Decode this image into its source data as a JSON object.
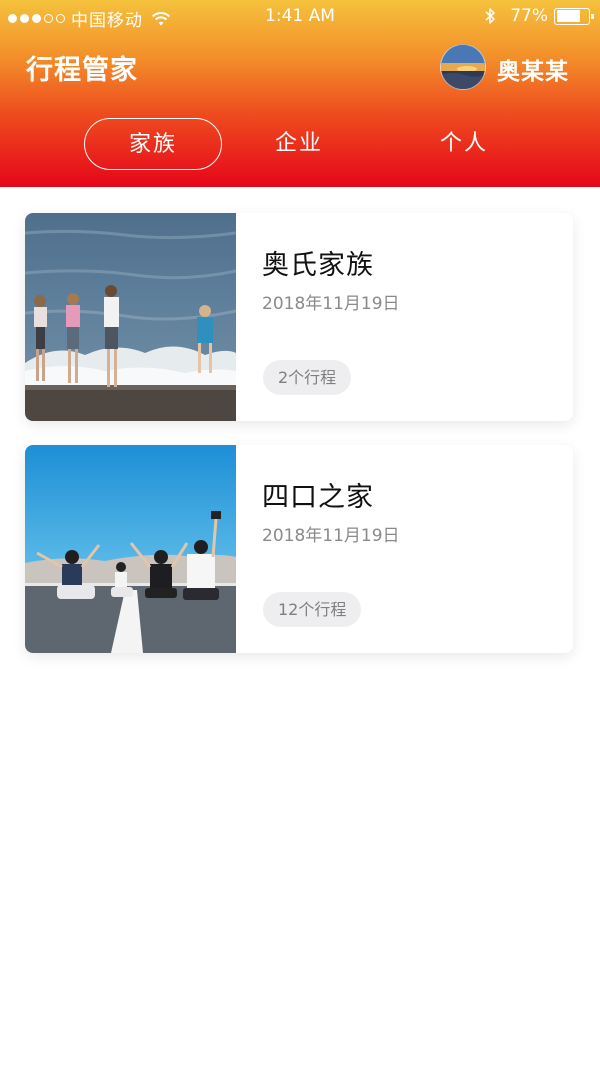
{
  "status_bar": {
    "carrier": "中国移动",
    "time": "1:41 AM",
    "battery": "77%",
    "battery_level": 0.77
  },
  "header": {
    "title": "行程管家",
    "user_name": "奥某某"
  },
  "tabs": [
    {
      "label": "家族",
      "active": true
    },
    {
      "label": "企业",
      "active": false
    },
    {
      "label": "个人",
      "active": false
    }
  ],
  "groups": [
    {
      "name": "奥氏家族",
      "date": "2018年11月19日",
      "trips": "2个行程",
      "photo": "family-beach-photo"
    },
    {
      "name": "四口之家",
      "date": "2018年11月19日",
      "trips": "12个行程",
      "photo": "family-road-photo"
    }
  ],
  "colors": {
    "header_top": "#f5c23d",
    "header_bottom": "#e5061a",
    "badge_bg": "#eeeef0"
  },
  "icons": {
    "signal": "signal-dots-icon",
    "wifi": "wifi-icon",
    "bluetooth": "bluetooth-icon",
    "battery": "battery-icon"
  }
}
